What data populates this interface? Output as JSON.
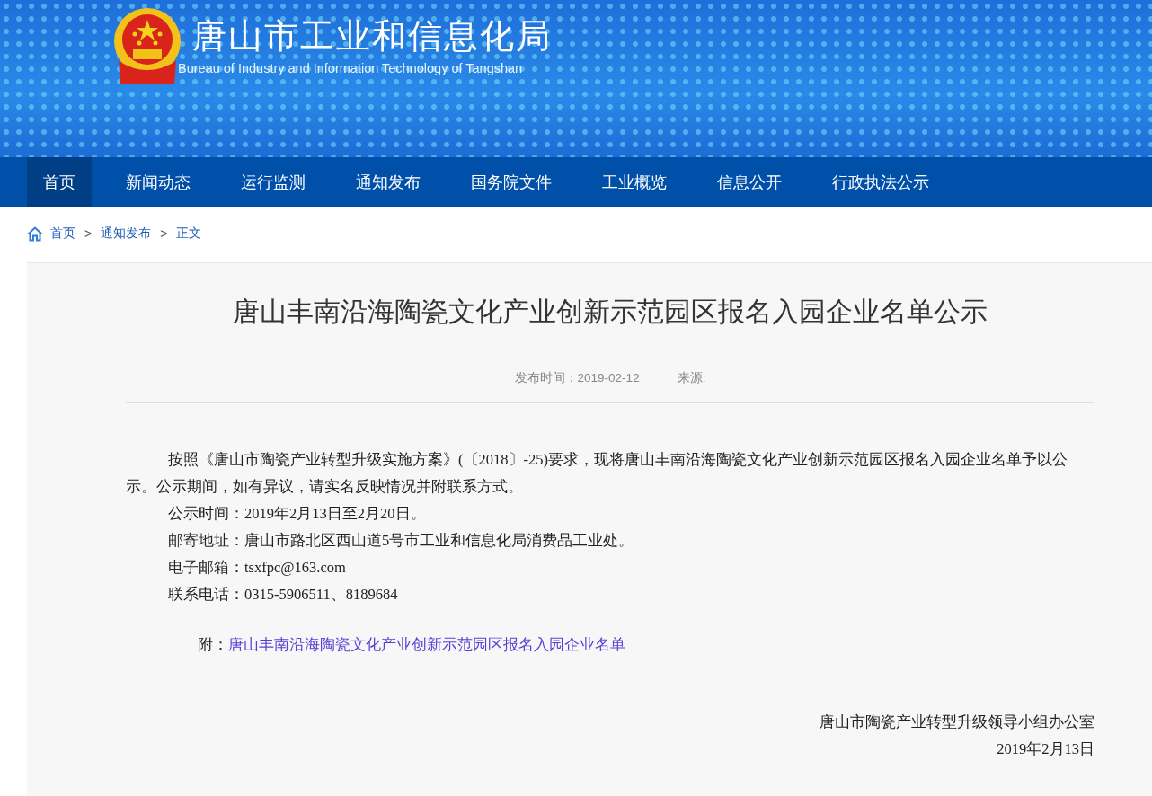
{
  "header": {
    "title": "唐山市工业和信息化局",
    "subtitle": "Bureau of Industry and Information Technology of Tangshan"
  },
  "nav": [
    {
      "label": "首页",
      "selected": true
    },
    {
      "label": "新闻动态",
      "selected": false
    },
    {
      "label": "运行监测",
      "selected": false
    },
    {
      "label": "通知发布",
      "selected": false
    },
    {
      "label": "国务院文件",
      "selected": false
    },
    {
      "label": "工业概览",
      "selected": false
    },
    {
      "label": "信息公开",
      "selected": false
    },
    {
      "label": "行政执法公示",
      "selected": false
    }
  ],
  "breadcrumb": [
    {
      "label": "首页"
    },
    {
      "label": "通知发布"
    },
    {
      "label": "正文"
    }
  ],
  "breadcrumb_separator": ">",
  "article": {
    "title": "唐山丰南沿海陶瓷文化产业创新示范园区报名入园企业名单公示",
    "publish_time": "发布时间：2019-02-12",
    "source": "来源:",
    "paragraphs": [
      "按照《唐山市陶瓷产业转型升级实施方案》(〔2018〕-25)要求，现将唐山丰南沿海陶瓷文化产业创新示范园区报名入园企业名单予以公示。公示期间，如有异议，请实名反映情况并附联系方式。",
      "公示时间：2019年2月13日至2月20日。",
      "邮寄地址：唐山市路北区西山道5号市工业和信息化局消费品工业处。",
      "电子邮箱：tsxfpc@163.com",
      "联系电话：0315-5906511、8189684"
    ],
    "attachment_label": "附：",
    "attachment_link": "唐山丰南沿海陶瓷文化产业创新示范园区报名入园企业名单",
    "signature": [
      "唐山市陶瓷产业转型升级领导小组办公室",
      "2019年2月13日"
    ]
  }
}
